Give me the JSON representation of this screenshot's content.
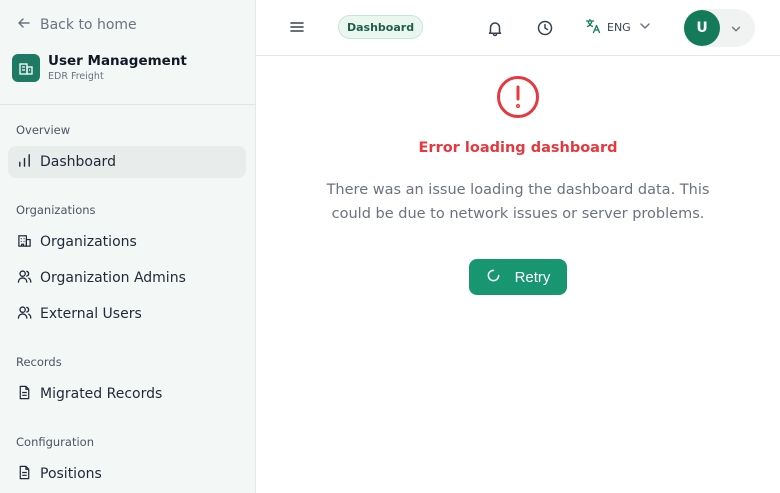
{
  "sidebar": {
    "back_label": "Back to home",
    "org_name": "User Management",
    "org_sub": "EDR Freight",
    "sections": {
      "overview": "Overview",
      "organizations": "Organizations",
      "records": "Records",
      "configuration": "Configuration"
    },
    "items": {
      "dashboard": "Dashboard",
      "organizations": "Organizations",
      "org_admins": "Organization Admins",
      "external_users": "External Users",
      "migrated_records": "Migrated Records",
      "positions": "Positions"
    },
    "active_item": "Dashboard"
  },
  "topbar": {
    "breadcrumb": "Dashboard",
    "language": "ENG",
    "avatar_initial": "U",
    "icons": [
      "menu-icon",
      "bell-icon",
      "clock-icon",
      "translate-icon",
      "chevron-down-icon"
    ]
  },
  "main": {
    "error_title": "Error loading dashboard",
    "error_message": "There was an issue loading the dashboard data. This could be due to network issues or server problems.",
    "retry_label": "Retry"
  },
  "colors": {
    "brand": "#157a5a",
    "button": "#179670",
    "error": "#e5393f",
    "sidebar_bg": "#f3f8f6"
  }
}
